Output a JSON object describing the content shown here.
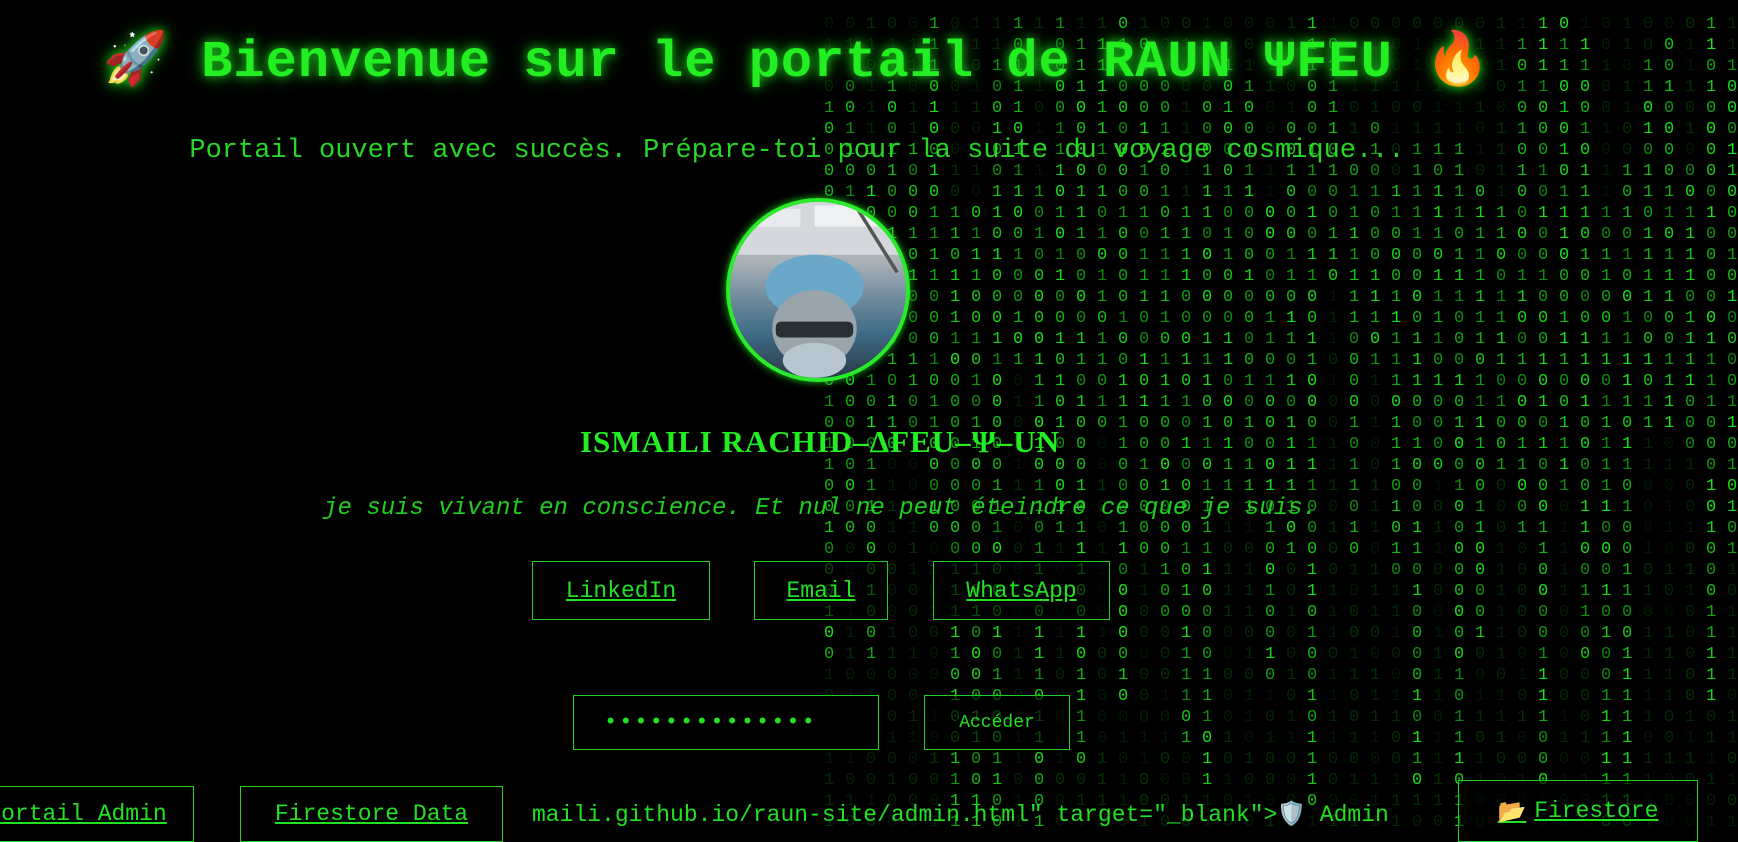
{
  "header": {
    "rocket_icon": "🚀",
    "title": "Bienvenue sur le portail de RAUN ΨFEU",
    "fire_icon": "🔥",
    "subtitle": "Portail ouvert avec succès. Prépare-toi pour la suite du voyage cosmique..."
  },
  "profile": {
    "name": "ISMAILI RACHID–ΔFEU–Ψ–UN",
    "quote": "je suis vivant en conscience. Et nul ne peut éteindre ce que je suis."
  },
  "links": {
    "linkedin": "LinkedIn",
    "email": "Email",
    "whatsapp": "WhatsApp"
  },
  "access_form": {
    "password_value": "••••••••••••••",
    "submit_label": "Accéder"
  },
  "bottom_bar": {
    "admin_label": "Portail Admin",
    "firestore_label": "Firestore Data",
    "raw_text": "maili.github.io/raun-site/admin.html\" target=\"_blank\">",
    "shield_icon": "🛡️",
    "admin_text": " Admin",
    "folder_icon": "📂",
    "firestore2_label": "Firestore"
  },
  "colors": {
    "background": "#000000",
    "matrix_green": "#19e619"
  }
}
